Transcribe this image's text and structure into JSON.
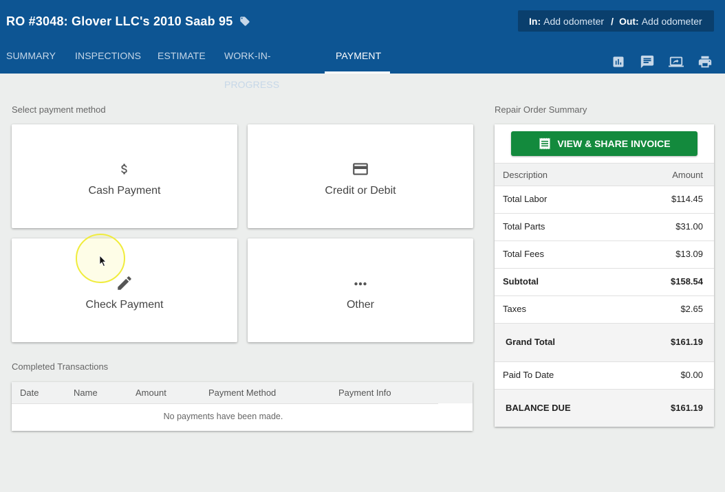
{
  "header": {
    "title": "RO #3048: Glover LLC's 2010 Saab 95",
    "odometer": {
      "in_label": "In:",
      "in_value": "Add odometer",
      "separator": "/",
      "out_label": "Out:",
      "out_value": "Add odometer"
    }
  },
  "tabs": [
    {
      "label": "SUMMARY"
    },
    {
      "label": "INSPECTIONS"
    },
    {
      "label": "ESTIMATE"
    },
    {
      "label": "WORK-IN-PROGRESS"
    },
    {
      "label": "PAYMENT",
      "active": true
    }
  ],
  "toolbar_icons": [
    "chart-icon",
    "message-icon",
    "screen-share-icon",
    "print-icon"
  ],
  "payment": {
    "section_label": "Select payment method",
    "methods": [
      {
        "label": "Cash Payment",
        "icon": "dollar-icon"
      },
      {
        "label": "Credit or Debit",
        "icon": "credit-card-icon"
      },
      {
        "label": "Check Payment",
        "icon": "pencil-icon"
      },
      {
        "label": "Other",
        "icon": "more-horiz-icon"
      }
    ]
  },
  "transactions": {
    "section_label": "Completed Transactions",
    "columns": [
      "Date",
      "Name",
      "Amount",
      "Payment Method",
      "Payment Info"
    ],
    "empty_text": "No payments have been made."
  },
  "summary": {
    "section_label": "Repair Order Summary",
    "invoice_button": "VIEW & SHARE INVOICE",
    "header": {
      "description": "Description",
      "amount": "Amount"
    },
    "rows": [
      {
        "description": "Total Labor",
        "amount": "$114.45"
      },
      {
        "description": "Total Parts",
        "amount": "$31.00"
      },
      {
        "description": "Total Fees",
        "amount": "$13.09"
      },
      {
        "description": "Subtotal",
        "amount": "$158.54"
      },
      {
        "description": "Taxes",
        "amount": "$2.65"
      },
      {
        "description": "Grand Total",
        "amount": "$161.19"
      },
      {
        "description": "Paid To Date",
        "amount": "$0.00"
      },
      {
        "description": "BALANCE DUE",
        "amount": "$161.19"
      }
    ]
  },
  "colors": {
    "header_bg": "#0d5593",
    "odometer_bg": "#0a3f6d",
    "invoice_button": "#138a3d",
    "page_bg": "#eceeed"
  }
}
